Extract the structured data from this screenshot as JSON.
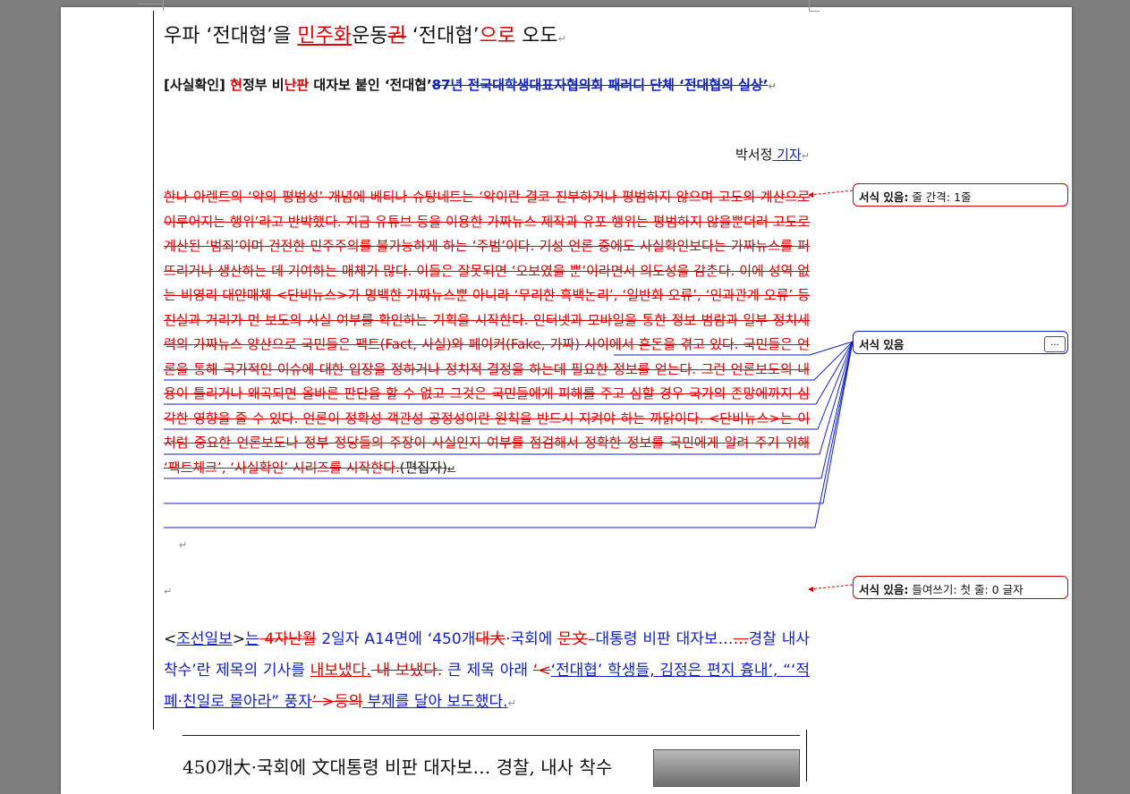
{
  "document": {
    "title": {
      "part1": "우파 ‘전대협’을 ",
      "part2": "민주화",
      "part3": "운동",
      "part4": "권",
      "part5": " ‘전대협’",
      "part6": "으로",
      "part7": "  오도"
    },
    "subtitle": {
      "part1": "[사실확인] ",
      "part2": "현",
      "part3": "정부 비",
      "part4": "난판",
      "part5": " 대자보 붙인 ‘전대협’",
      "part6": "87년 전국대학생대표자협의회 패러디 단체 ‘전대협의 실상’"
    },
    "byline": {
      "name": "박서정",
      "role": " 기자"
    },
    "body": {
      "deleted": "한나 아렌트의 ‘악의 평범성’ 개념에 베티나 슈탕네트는 ‘악이란 결코 진부하거나 평범하지 않으며 고도의 계산으로 이루어지는 행위’라고 반박했다. 지금 유튜브 등을 이용한 가짜뉴스 제작과 유포 행위는 평범하지 않을뿐더러 고도로 계산된 ‘범죄’이며 건전한 민주주의를 불가능하게 하는 ‘주범’이다. 기성 언론 중에도 사실확인보다는 가짜뉴스를 퍼뜨리거나 생산하는 데 기여하는 매체가 많다. 이들은 잘못되면 ‘오보였을 뿐’이라면서 의도성을 감춘다. 이에 성역 없는 비영리 대안매체 <단비뉴스>가 명백한 가짜뉴스뿐 아니라 ‘무리한 흑백논리’, ‘일반화 오류’, ‘인과관계 오류’ 등 진실과 거리가 먼 보도의 사실 여부를 확인하는 기획을 시작한다. 인터넷과 모바일을 통한 정보 범람과 일부 정치세력의 가짜뉴스 양산으로 국민들은 팩트(Fact, 사실)와 페이커(Fake, 가짜) 사이에서 혼돈을 겪고 있다. 국민들은 언론을 통해 국가적인 이슈에 대한 입장을 정하거나 정치적 결정을 하는데 필요한 정보를 얻는다. 그런 언론보도의 내용이 틀리거나 왜곡되면 올바른 판단을 할 수 없고 그것은 국민들에게 피해를 주고 심할 경우 국가의 존망에까지 심각한 영향을 줄 수 있다. 언론이 정확성 객관성 공정성이란 원칙을 반드시 지켜야 하는 까닭이다. <단비뉴스>는 이처럼 중요한 언론보도나 정부 정당들의 주장이 사실인지 여부를 점검해서 정확한 정보를 국민에게 알려 주기 위해 ‘팩트체크’, ‘사실확인’ 시리즈를 시작한다.",
      "kept": "(편집자)"
    },
    "quote": {
      "p1": "<",
      "p2": "조선일보",
      "p3": ">",
      "p4": "는",
      "p5": " 4자난월",
      "p6": " 2일자 A14면에 ‘450개",
      "p7": "대大",
      "p8": "·국회에 ",
      "p9": "문文",
      "p10": "–대통령 비판 대자보…",
      "p11": "…",
      "p12": "경찰 내사 착수’란 제목의 기사를 ",
      "p13": "내보냈다.",
      "p14": " 내 보냈다.",
      "p15": " 큰 제목 아래 ",
      "p16": "‘<",
      "p17": "‘전대협’ 학생들, 김정은 편지 흉내’, “‘적폐·친일로 몰아라” 풍자",
      "p18": "’ >",
      "p19": "등의",
      "p20": " 부제를 달아 보도했다."
    },
    "newspaper_clip": {
      "headline": "450개大·국회에 文대통령 비판 대자보… 경찰, 내사 착수"
    }
  },
  "balloons": [
    {
      "label": "서식 있음:",
      "detail": " 줄 간격: 1줄"
    },
    {
      "label": "서식 있음",
      "detail": "",
      "more": "..."
    },
    {
      "label": "서식 있음:",
      "detail": " 들여쓰기: 첫 줄:  0 글자"
    }
  ],
  "marks": {
    "paragraph": "↵"
  },
  "colors": {
    "deleted": "#e00000",
    "inserted": "#1020c8",
    "page": "#ffffff",
    "background": "#7f7f7f"
  }
}
